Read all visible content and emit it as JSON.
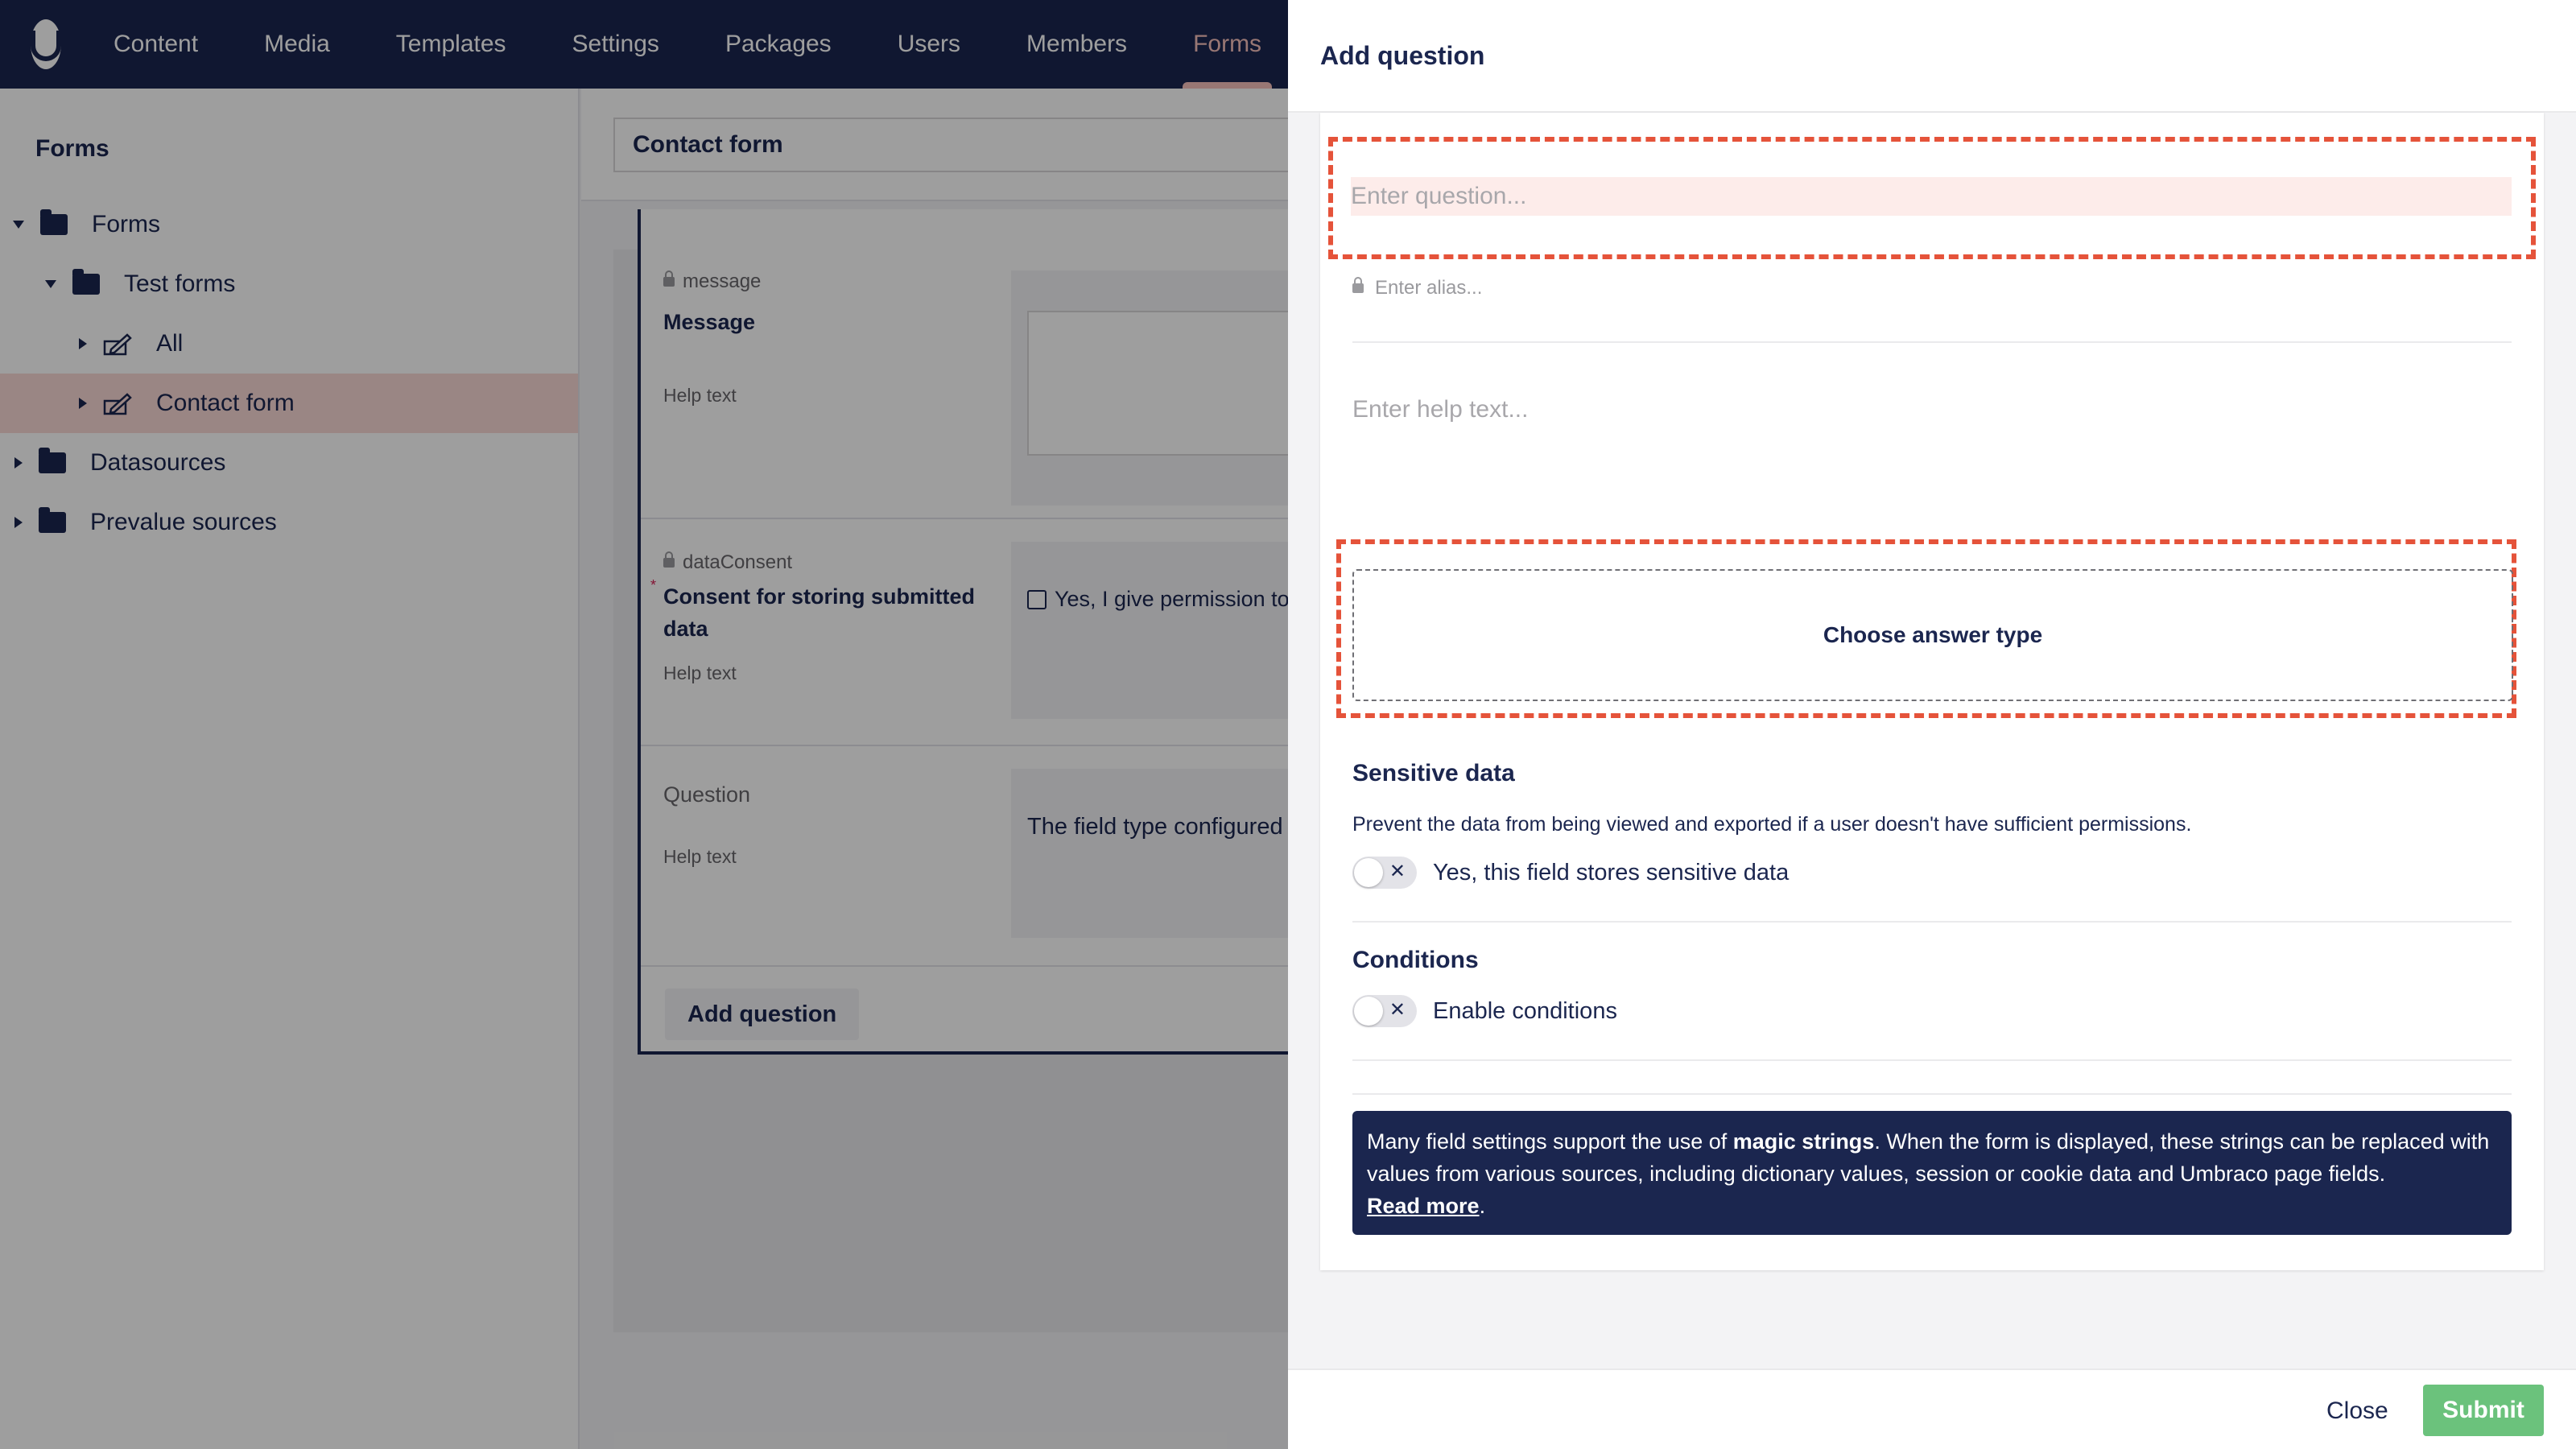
{
  "nav": {
    "items": [
      "Content",
      "Media",
      "Templates",
      "Settings",
      "Packages",
      "Users",
      "Members",
      "Forms"
    ],
    "active": "Forms"
  },
  "sidebar": {
    "title": "Forms",
    "tree": [
      {
        "label": "Forms",
        "icon": "folder-icon"
      },
      {
        "label": "Test forms",
        "icon": "folder-icon"
      },
      {
        "label": "All",
        "icon": "form-icon"
      },
      {
        "label": "Contact form",
        "icon": "form-icon",
        "selected": true
      },
      {
        "label": "Datasources",
        "icon": "folder-icon"
      },
      {
        "label": "Prevalue sources",
        "icon": "folder-icon"
      }
    ]
  },
  "editor": {
    "form_name": "Contact form",
    "questions": [
      {
        "alias": "message",
        "label": "Message",
        "help": "Help text"
      },
      {
        "alias": "dataConsent",
        "label": "Consent for storing submitted data",
        "help": "Help text",
        "required_mark": "*",
        "preview": "Yes, I give permission to"
      },
      {
        "label": "Question",
        "help": "Help text",
        "preview": "The field type configured"
      }
    ],
    "add_question_label": "Add question"
  },
  "drawer": {
    "title": "Add question",
    "question_placeholder": "Enter question...",
    "alias_placeholder": "Enter alias...",
    "help_placeholder": "Enter help text...",
    "answer_type_label": "Choose answer type",
    "sensitive": {
      "title": "Sensitive data",
      "description": "Prevent the data from being viewed and exported if a user doesn't have sufficient permissions.",
      "toggle_label": "Yes, this field stores sensitive data"
    },
    "conditions": {
      "title": "Conditions",
      "toggle_label": "Enable conditions"
    },
    "info": {
      "text_before": "Many field settings support the use of ",
      "bold": "magic strings",
      "text_after": ". When the form is displayed, these strings can be replaced with values from various sources, including dictionary values, session or cookie data and Umbraco page fields.",
      "link": "Read more",
      "end": "."
    },
    "close_label": "Close",
    "submit_label": "Submit"
  },
  "colors": {
    "nav_bg": "#1b264f",
    "accent": "#f5c1bc",
    "highlight": "#e5533a",
    "submit": "#6bc27c"
  }
}
